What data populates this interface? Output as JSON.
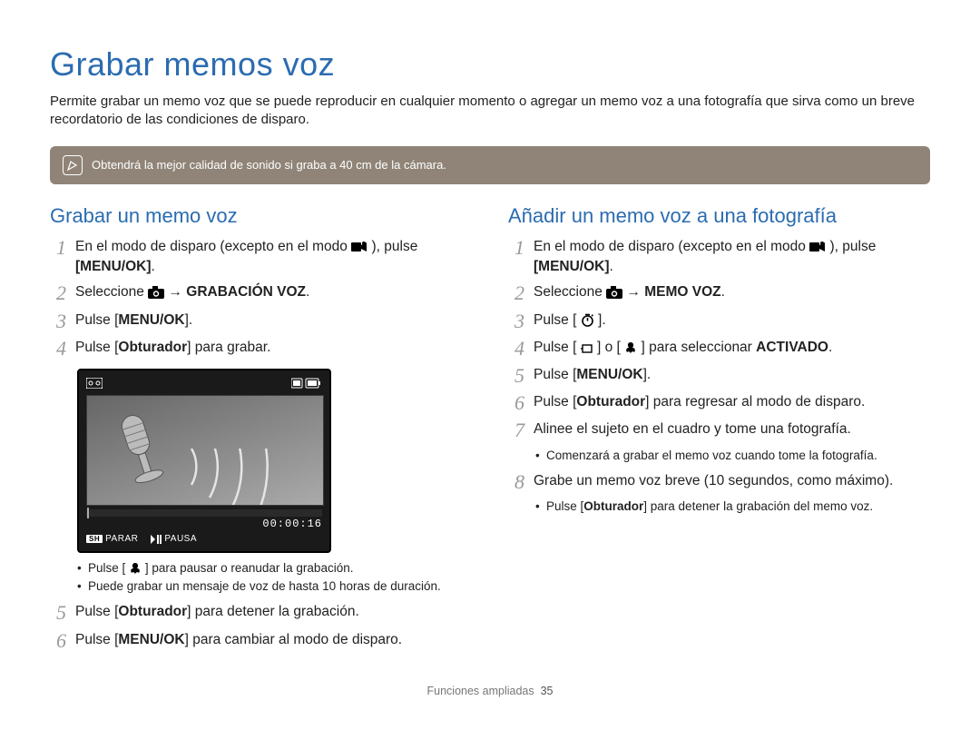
{
  "title": "Grabar memos voz",
  "intro": "Permite grabar un memo voz que se puede reproducir en cualquier momento o agregar un memo voz a una fotografía que sirva como un breve recordatorio de las condiciones de disparo.",
  "tip": "Obtendrá la mejor calidad de sonido si graba a 40 cm de la cámara.",
  "left": {
    "heading": "Grabar un memo voz",
    "s1a": "En el modo de disparo (excepto en el modo ",
    "s1b": "), pulse ",
    "s1c": "[MENU/OK]",
    "s1d": ".",
    "s2a": "Seleccione ",
    "s2b": " → ",
    "s2c": "GRABACIÓN VOZ",
    "s2d": ".",
    "s3a": "Pulse [",
    "s3b": "MENU/OK",
    "s3c": "].",
    "s4a": "Pulse [",
    "s4b": "Obturador",
    "s4c": "] para grabar.",
    "b1a": "Pulse [",
    "b1b": "] para pausar o reanudar la grabación.",
    "b2": "Puede grabar un mensaje de voz de hasta 10 horas de duración.",
    "s5a": "Pulse [",
    "s5b": "Obturador",
    "s5c": "] para detener la grabación.",
    "s6a": "Pulse [",
    "s6b": "MENU/OK",
    "s6c": "] para cambiar al modo de disparo."
  },
  "right": {
    "heading": "Añadir un memo voz a una fotografía",
    "s1a": "En el modo de disparo (excepto en el modo ",
    "s1b": "), pulse ",
    "s1c": "[MENU/OK]",
    "s1d": ".",
    "s2a": "Seleccione ",
    "s2b": " → ",
    "s2c": "MEMO VOZ",
    "s2d": ".",
    "s3a": "Pulse [",
    "s3b": "].",
    "s4a": "Pulse [",
    "s4b": "] o [",
    "s4c": "] para seleccionar ",
    "s4d": "ACTIVADO",
    "s4e": ".",
    "s5a": "Pulse [",
    "s5b": "MENU/OK",
    "s5c": "].",
    "s6a": "Pulse [",
    "s6b": "Obturador",
    "s6c": "] para regresar al modo de disparo.",
    "s7": "Alinee el sujeto en el cuadro y tome una fotografía.",
    "b7": "Comenzará a grabar el memo voz cuando tome la fotografía.",
    "s8": "Grabe un memo voz breve (10 segundos, como máximo).",
    "b8a": "Pulse [",
    "b8b": "Obturador",
    "b8c": "] para detener la grabación del memo voz."
  },
  "lcd": {
    "time": "00:00:16",
    "parar": "PARAR",
    "pausa": "PAUSA",
    "sh": "SH"
  },
  "footer": {
    "section": "Funciones ampliadas",
    "page": "35"
  }
}
